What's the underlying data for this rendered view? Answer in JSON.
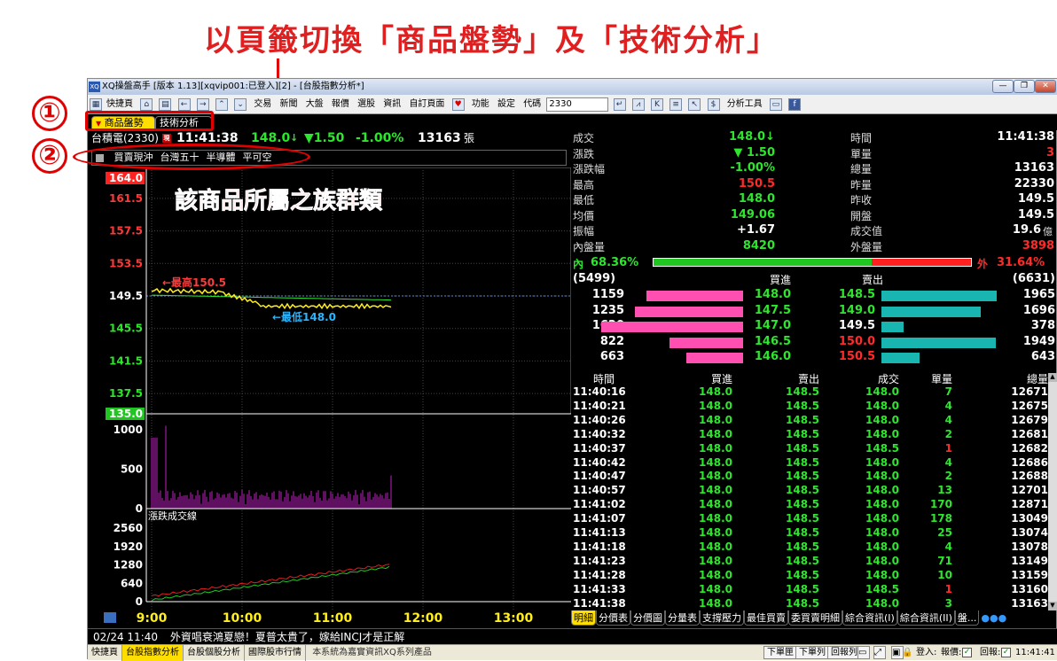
{
  "annotations": {
    "title": "以頁籤切換「商品盤勢」及「技術分析」",
    "marker1": "①",
    "marker2": "②",
    "chart_note": "該商品所屬之族群類"
  },
  "window": {
    "title": "XQ操盤高手 [版本 1.13][xqvip001:已登入][2] - [台股指數分析*]",
    "app_icon": "XQ"
  },
  "toolbar": {
    "quick_page": "快捷頁",
    "trade": "交易",
    "news": "新聞",
    "market": "大盤",
    "quote": "報價",
    "stock_pick": "選股",
    "info": "資訊",
    "custom_page": "自訂頁面",
    "functions": "功能",
    "settings": "設定",
    "code_label": "代碼",
    "code_value": "2330",
    "analysis_tools": "分析工具"
  },
  "tabs": {
    "active": "商品盤勢",
    "inactive": "技術分析"
  },
  "quote": {
    "name": "台積電(2330)",
    "badge": "現",
    "time": "11:41:38",
    "price": "148.0",
    "change": "▼1.50",
    "pct": "-1.00%",
    "volume": "13163",
    "vol_unit": "張"
  },
  "groups": [
    "買賣現沖",
    "台灣五十",
    "半導體",
    "平可空"
  ],
  "chart": {
    "price_ticks": [
      "164.0",
      "161.5",
      "157.5",
      "153.5",
      "149.5",
      "145.5",
      "141.5",
      "137.5",
      "135.0"
    ],
    "vol_ticks": [
      "1000",
      "500",
      "0"
    ],
    "adl_label": "漲跌成交線",
    "adl_ticks": [
      "2560",
      "1920",
      "1280",
      "640",
      "0"
    ],
    "time_ticks": [
      "9:00",
      "10:00",
      "11:00",
      "12:00",
      "13:00"
    ],
    "high_label": "←最高150.5",
    "low_label": "←最低148.0"
  },
  "stats": {
    "left": [
      {
        "label": "成交",
        "value": "148.0↓",
        "color": "g"
      },
      {
        "label": "漲跌",
        "value": "▼ 1.50",
        "color": "g"
      },
      {
        "label": "漲跌幅",
        "value": "-1.00%",
        "color": "g"
      },
      {
        "label": "最高",
        "value": "150.5",
        "color": "r"
      },
      {
        "label": "最低",
        "value": "148.0",
        "color": "g"
      },
      {
        "label": "均價",
        "value": "149.06",
        "color": "g"
      },
      {
        "label": "振幅",
        "value": "+1.67",
        "color": "w"
      },
      {
        "label": "內盤量",
        "value": "8420",
        "color": "g"
      }
    ],
    "right": [
      {
        "label": "時間",
        "value": "11:41:38",
        "color": "w"
      },
      {
        "label": "單量",
        "value": "3",
        "color": "r"
      },
      {
        "label": "總量",
        "value": "13163",
        "color": "w"
      },
      {
        "label": "昨量",
        "value": "22330",
        "color": "w"
      },
      {
        "label": "昨收",
        "value": "149.5",
        "color": "w"
      },
      {
        "label": "開盤",
        "value": "149.5",
        "color": "w"
      },
      {
        "label": "成交值",
        "value": "19.6",
        "color": "w",
        "unit": "億"
      },
      {
        "label": "外盤量",
        "value": "3898",
        "color": "r"
      }
    ],
    "inner_label": "內",
    "inner_pct": "68.36%",
    "inner_ratio": 0.6836,
    "outer_label": "外",
    "outer_pct": "31.64%"
  },
  "orderbook": {
    "bid_total": "(5499)",
    "ask_total": "(6631)",
    "bid_header": "買進",
    "ask_header": "賣出",
    "rows": [
      {
        "bid_qty": "1159",
        "bid": "148.0",
        "ask": "148.5",
        "ask_qty": "1965",
        "bid_frac": 0.17,
        "ask_frac": 1.0,
        "ask_color": "g"
      },
      {
        "bid_qty": "1235",
        "bid": "147.5",
        "ask": "149.0",
        "ask_qty": "1696",
        "bid_frac": 0.19,
        "ask_frac": 0.86,
        "ask_color": "g"
      },
      {
        "bid_qty": "1620",
        "bid": "147.0",
        "ask": "149.5",
        "ask_qty": "378",
        "bid_frac": 0.25,
        "ask_frac": 0.19,
        "ask_color": "w"
      },
      {
        "bid_qty": "822",
        "bid": "146.5",
        "ask": "150.0",
        "ask_qty": "1949",
        "bid_frac": 0.13,
        "ask_frac": 0.99,
        "ask_color": "r"
      },
      {
        "bid_qty": "663",
        "bid": "146.0",
        "ask": "150.5",
        "ask_qty": "643",
        "bid_frac": 0.1,
        "ask_frac": 0.33,
        "ask_color": "r"
      }
    ]
  },
  "ticks": {
    "headers": [
      "時間",
      "買進",
      "賣出",
      "成交",
      "單量",
      "總量"
    ],
    "rows": [
      {
        "t": "11:40:16",
        "b": "148.0",
        "s": "148.5",
        "p": "148.0",
        "q": "7",
        "v": "12671",
        "pc": "g",
        "qc": "g"
      },
      {
        "t": "11:40:21",
        "b": "148.0",
        "s": "148.5",
        "p": "148.0",
        "q": "4",
        "v": "12675",
        "pc": "g",
        "qc": "g"
      },
      {
        "t": "11:40:26",
        "b": "148.0",
        "s": "148.5",
        "p": "148.0",
        "q": "4",
        "v": "12679",
        "pc": "g",
        "qc": "g"
      },
      {
        "t": "11:40:32",
        "b": "148.0",
        "s": "148.5",
        "p": "148.0",
        "q": "2",
        "v": "12681",
        "pc": "g",
        "qc": "g"
      },
      {
        "t": "11:40:37",
        "b": "148.0",
        "s": "148.5",
        "p": "148.5",
        "q": "1",
        "v": "12682",
        "pc": "g",
        "qc": "r"
      },
      {
        "t": "11:40:42",
        "b": "148.0",
        "s": "148.5",
        "p": "148.0",
        "q": "4",
        "v": "12686",
        "pc": "g",
        "qc": "g"
      },
      {
        "t": "11:40:47",
        "b": "148.0",
        "s": "148.5",
        "p": "148.0",
        "q": "2",
        "v": "12688",
        "pc": "g",
        "qc": "g"
      },
      {
        "t": "11:40:57",
        "b": "148.0",
        "s": "148.5",
        "p": "148.0",
        "q": "13",
        "v": "12701",
        "pc": "g",
        "qc": "g"
      },
      {
        "t": "11:41:02",
        "b": "148.0",
        "s": "148.5",
        "p": "148.0",
        "q": "170",
        "v": "12871",
        "pc": "g",
        "qc": "g"
      },
      {
        "t": "11:41:07",
        "b": "148.0",
        "s": "148.5",
        "p": "148.0",
        "q": "178",
        "v": "13049",
        "pc": "g",
        "qc": "g"
      },
      {
        "t": "11:41:13",
        "b": "148.0",
        "s": "148.5",
        "p": "148.0",
        "q": "25",
        "v": "13074",
        "pc": "g",
        "qc": "g"
      },
      {
        "t": "11:41:18",
        "b": "148.0",
        "s": "148.5",
        "p": "148.0",
        "q": "4",
        "v": "13078",
        "pc": "g",
        "qc": "g"
      },
      {
        "t": "11:41:23",
        "b": "148.0",
        "s": "148.5",
        "p": "148.0",
        "q": "71",
        "v": "13149",
        "pc": "g",
        "qc": "g"
      },
      {
        "t": "11:41:28",
        "b": "148.0",
        "s": "148.5",
        "p": "148.0",
        "q": "10",
        "v": "13159",
        "pc": "g",
        "qc": "g"
      },
      {
        "t": "11:41:33",
        "b": "148.0",
        "s": "148.5",
        "p": "148.5",
        "q": "1",
        "v": "13160",
        "pc": "g",
        "qc": "r"
      },
      {
        "t": "11:41:38",
        "b": "148.0",
        "s": "148.5",
        "p": "148.0",
        "q": "3",
        "v": "13163",
        "pc": "g",
        "qc": "g"
      }
    ]
  },
  "bottom_tabs": [
    "明細",
    "分價表",
    "分價圖",
    "分量表",
    "支撐壓力",
    "最佳買賣",
    "委買賣明細",
    "綜合資訊(I)",
    "綜合資訊(II)",
    "盤..."
  ],
  "news": {
    "time": "02/24 11:40",
    "headline": "外資唱衰鴻夏戀！夏普太貴了，嫁給INCJ才是正解"
  },
  "statusbar": {
    "tabs": [
      "快捷頁",
      "台股指數分析",
      "台股個股分析",
      "國際股市行情"
    ],
    "active": "台股指數分析",
    "notice": "本系統為嘉實資訊XQ系列產品",
    "order_down": "下單匣",
    "order_list": "下單列",
    "report": "回報列",
    "login": "登入:",
    "quote_label": "報價:",
    "reply_label": "回報:",
    "clock": "11:41:41"
  },
  "colors": {
    "up": "#ff2a2a",
    "down": "#2de62d",
    "flat": "#ffffff",
    "pink": "#ff4fb0",
    "teal": "#19b5b0",
    "annotation": "#e00000"
  }
}
